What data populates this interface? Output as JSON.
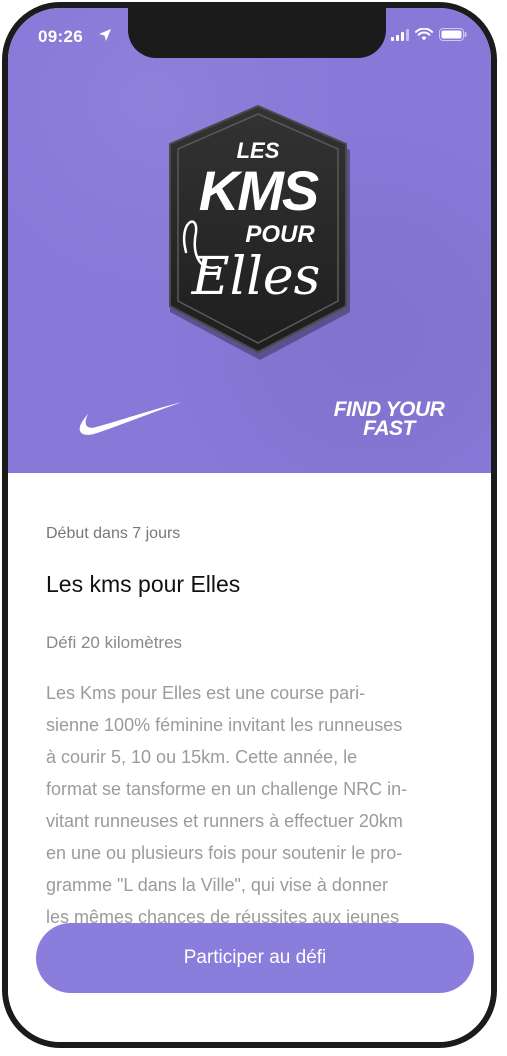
{
  "status_bar": {
    "time": "09:26"
  },
  "hero": {
    "badge": {
      "line1": "LES",
      "line2": "KMS",
      "line3": "POUR",
      "line4": "Elles"
    },
    "tagline_line1": "FIND YOUR",
    "tagline_line2": "FAST",
    "brand_icon": "nike-swoosh-icon"
  },
  "challenge": {
    "start_text": "Début dans 7 jours",
    "title": "Les kms pour Elles",
    "subtitle": "Défi 20 kilomètres",
    "description_lines": [
      "Les Kms pour Elles est une course pari-",
      "sienne 100% féminine invitant les runneuses",
      "à courir 5, 10 ou 15km. Cette année, le",
      "format se tansforme en un challenge NRC in-",
      "vitant runneuses et runners à effectuer 20km",
      "en une ou plusieurs fois pour soutenir le pro-",
      "gramme \"L dans la Ville\", qui vise à donner",
      "les mêmes chances de réussites aux jeunes"
    ]
  },
  "cta": {
    "label": "Participer au défi"
  },
  "colors": {
    "accent": "#8a7ddb",
    "hero_bg": "#8878d8"
  }
}
